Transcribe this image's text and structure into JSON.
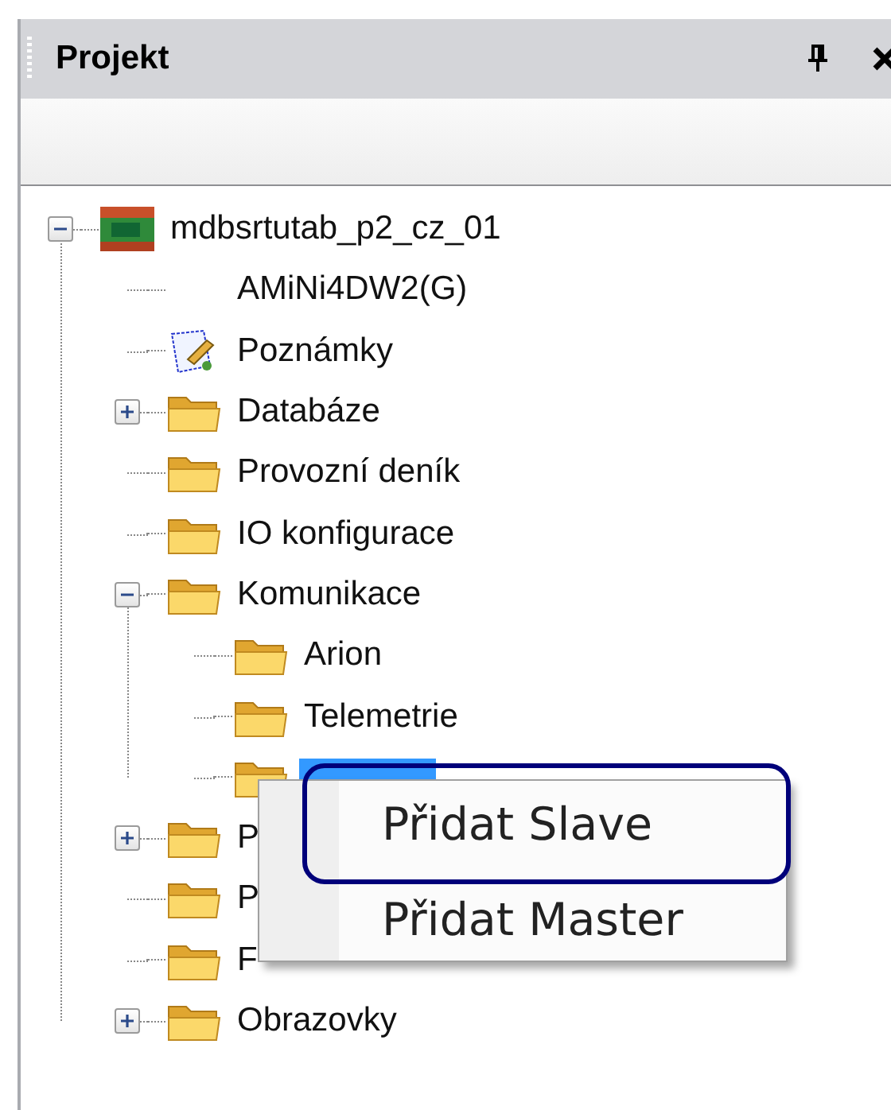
{
  "panel": {
    "title": "Projekt"
  },
  "tree": [
    {
      "label": "mdbsrtutab_p2_cz_01",
      "kind": "device",
      "expanded": true,
      "selected": false,
      "children": [
        {
          "label": "AMiNi4DW2(G)",
          "kind": "blank",
          "selected": false
        },
        {
          "label": "Poznámky",
          "kind": "notes",
          "selected": false
        },
        {
          "label": "Databáze",
          "kind": "folder",
          "expanded": false,
          "selected": false
        },
        {
          "label": "Provozní deník",
          "kind": "folder",
          "selected": false
        },
        {
          "label": "IO konfigurace",
          "kind": "folder",
          "selected": false
        },
        {
          "label": "Komunikace",
          "kind": "folder",
          "expanded": true,
          "selected": false,
          "children": [
            {
              "label": "Arion",
              "kind": "folder",
              "selected": false
            },
            {
              "label": "Telemetrie",
              "kind": "folder",
              "selected": false
            },
            {
              "kind": "folder",
              "selected": true
            }
          ]
        },
        {
          "label": "P",
          "kind": "folder",
          "expanded": false,
          "selected": false
        },
        {
          "label": "P",
          "kind": "folder",
          "selected": false
        },
        {
          "label": "F",
          "kind": "folder",
          "selected": false
        },
        {
          "label": "Obrazovky",
          "kind": "folder",
          "expanded": false,
          "selected": false
        }
      ]
    }
  ],
  "context_menu": {
    "items": [
      {
        "label": "Přidat Slave",
        "selected": true
      },
      {
        "label": "Přidat Master",
        "selected": false
      }
    ]
  }
}
